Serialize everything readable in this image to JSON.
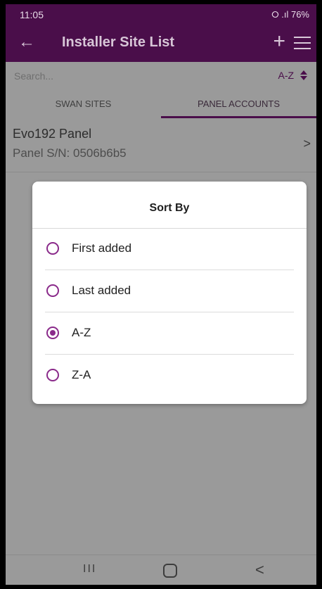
{
  "status": {
    "time": "11:05",
    "right": "⭘ .ıl 76%"
  },
  "appbar": {
    "title": "Installer Site List",
    "back_icon": "←",
    "add_icon": "+"
  },
  "search": {
    "placeholder": "Search...",
    "sort_label": "A-Z"
  },
  "tabs": [
    {
      "label": "SWAN SITES"
    },
    {
      "label": "PANEL ACCOUNTS"
    }
  ],
  "list": [
    {
      "title": "Evo192 Panel",
      "subtitle": "Panel S/N: 0506b6b5"
    }
  ],
  "dialog": {
    "title": "Sort By",
    "options": [
      {
        "label": "First added",
        "selected": false
      },
      {
        "label": "Last added",
        "selected": false
      },
      {
        "label": "A-Z",
        "selected": true
      },
      {
        "label": "Z-A",
        "selected": false
      }
    ]
  },
  "colors": {
    "primary": "#4a0e4a",
    "accent": "#8a2a8a"
  }
}
